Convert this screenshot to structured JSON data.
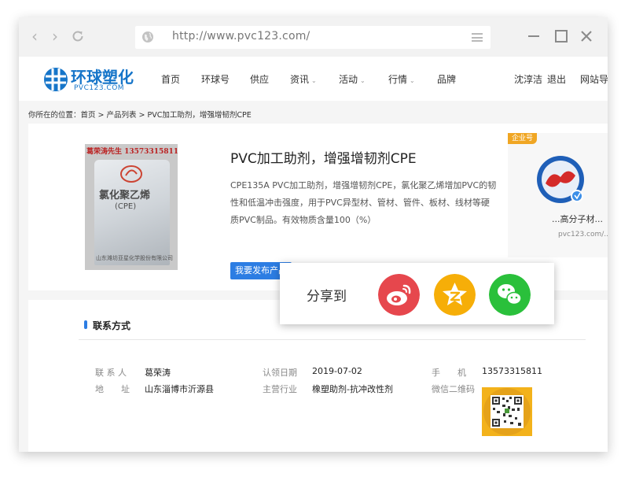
{
  "browser": {
    "url": "http://www.pvc123.com/",
    "colors": {
      "chrome_bg": "#f2f2f2",
      "icon": "#b5b5b5"
    }
  },
  "site": {
    "logo_text": "环球塑化",
    "logo_sub": "PVC123.COM",
    "nav": {
      "home": "首页",
      "hqh": "环球号",
      "supply": "供应",
      "news": "资讯",
      "activity": "活动",
      "market": "行情",
      "brand": "品牌"
    },
    "user": {
      "name": "沈淳洁",
      "logout": "退出",
      "site_nav": "网站导"
    }
  },
  "breadcrumb": "你所在的位置：首页 > 产品列表 > PVC加工助剂，增强增韧剂CPE",
  "product": {
    "title": "PVC加工助剂，增强增韧剂CPE",
    "description": "CPE135A PVC加工助剂，增强增韧剂CPE，氯化聚乙烯增加PVC的韧性和低温冲击强度，用于PVC异型材、管材、管件、板材、线材等硬质PVC制品。有效物质含量100（%）",
    "publish_button": "我要发布产品",
    "image": {
      "seller_line": "葛荣涛先生  13573315811",
      "bag_title": "氯化聚乙烯",
      "bag_sub": "(CPE)",
      "bag_footer": "山东潍坊亚星化学股份有限公司"
    }
  },
  "company": {
    "badge": "企业号",
    "name": "...高分子材...",
    "url": "pvc123.com/..."
  },
  "share": {
    "label": "分享到",
    "targets": [
      "weibo-icon",
      "qzone-icon",
      "wechat-icon"
    ],
    "colors": {
      "weibo": "#e6474d",
      "qzone": "#f6ae08",
      "wechat": "#2ac03b"
    }
  },
  "contact": {
    "section_title": "联系方式",
    "contact_person_label": "联 系 人",
    "contact_person": "葛荣涛",
    "address_label": "地　　址",
    "address": "山东淄博市沂源县",
    "cert_date_label": "认领日期",
    "cert_date": "2019-07-02",
    "industry_label": "主营行业",
    "industry": "橡塑助剂-抗冲改性剂",
    "phone_label": "手　　机",
    "phone": "13573315811",
    "wechat_qr_label": "微信二维码"
  }
}
